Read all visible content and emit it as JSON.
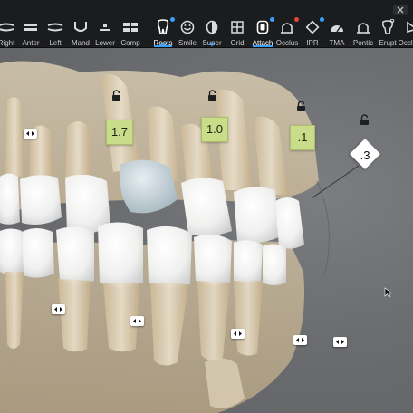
{
  "toolbar": {
    "tools": [
      {
        "label": "Right",
        "icon": "right-view-icon"
      },
      {
        "label": "Anter",
        "icon": "anterior-view-icon"
      },
      {
        "label": "Left",
        "icon": "left-view-icon"
      },
      {
        "label": "Mand",
        "icon": "mandible-view-icon"
      },
      {
        "label": "Lower",
        "icon": "lower-view-icon"
      },
      {
        "label": "Comp",
        "icon": "compare-icon"
      },
      {
        "label": "Roots",
        "icon": "roots-icon"
      },
      {
        "label": "Smile",
        "icon": "smile-icon"
      },
      {
        "label": "Super",
        "icon": "superimpose-icon"
      },
      {
        "label": "Grid",
        "icon": "grid-icon"
      },
      {
        "label": "Attach",
        "icon": "attachments-icon"
      },
      {
        "label": "Occlus",
        "icon": "occlusion-icon"
      },
      {
        "label": "IPR",
        "icon": "ipr-icon"
      },
      {
        "label": "TMA",
        "icon": "tma-icon"
      },
      {
        "label": "Pontic",
        "icon": "pontic-icon"
      },
      {
        "label": "Erupt",
        "icon": "eruption-icon"
      },
      {
        "label": "Occlusal",
        "icon": "occlusal-view-icon"
      }
    ],
    "active_tools": [
      "Roots",
      "Attach"
    ],
    "colors": {
      "accent": "#3aa0ff",
      "alert": "#e0463c"
    }
  },
  "viewport": {
    "movement_badges": [
      {
        "value": "1.7"
      },
      {
        "value": "1.0"
      },
      {
        "value": ".1"
      }
    ],
    "ipr_marker": {
      "value": ".3"
    },
    "badge_color": "#c8dc8a"
  }
}
